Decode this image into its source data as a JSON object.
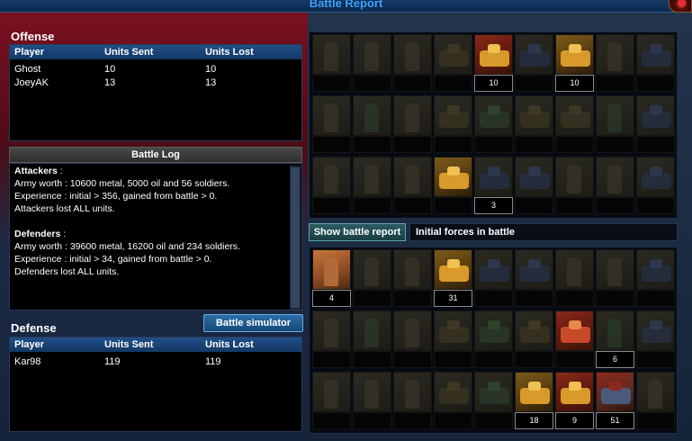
{
  "title": "Battle Report",
  "offense": {
    "heading": "Offense",
    "columns": [
      "Player",
      "Units Sent",
      "Units Lost"
    ],
    "rows": [
      [
        "Ghost",
        "10",
        "10"
      ],
      [
        "JoeyAK",
        "13",
        "13"
      ]
    ]
  },
  "battle_log": {
    "heading": "Battle Log",
    "attackers_title": "Attackers",
    "attackers_lines": [
      "Army worth : 10600 metal, 5000 oil and 56 soldiers.",
      "Experience : initial > 356, gained from battle > 0.",
      "Attackers lost ALL units."
    ],
    "defenders_title": "Defenders",
    "defenders_lines": [
      "Army worth : 39600 metal, 16200 oil and 234 soldiers.",
      "Experience : initial > 34, gained from battle > 0.",
      "Defenders lost ALL units."
    ]
  },
  "defense": {
    "heading": "Defense",
    "simulator_button": "Battle simulator",
    "columns": [
      "Player",
      "Units Sent",
      "Units Lost"
    ],
    "rows": [
      [
        "Kar98",
        "119",
        "119"
      ]
    ]
  },
  "buttons": {
    "show_report": "Show battle report",
    "initial_forces": "Initial forces in battle"
  },
  "attacker_grid": {
    "counts": [
      "",
      "",
      "",
      "",
      "10",
      "",
      "10",
      "",
      "",
      "",
      "",
      "",
      "",
      "",
      "",
      "",
      "",
      "",
      "",
      "",
      "",
      "",
      "3",
      "",
      "",
      "",
      ""
    ]
  },
  "defender_grid": {
    "counts": [
      "4",
      "",
      "",
      "31",
      "",
      "",
      "",
      "",
      "",
      "",
      "",
      "",
      "",
      "",
      "",
      "",
      "6",
      "",
      "",
      "",
      "",
      "",
      "",
      "18",
      "9",
      "51",
      "",
      "",
      ""
    ]
  }
}
